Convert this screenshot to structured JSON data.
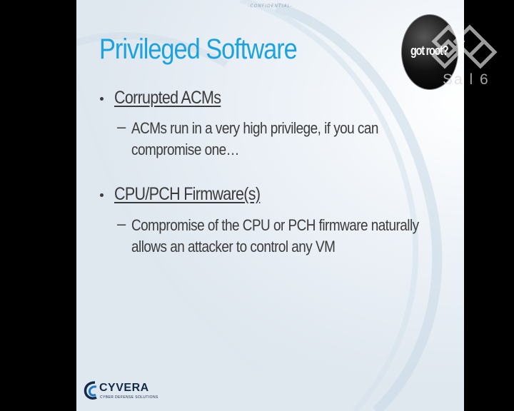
{
  "slide": {
    "confidential_label": "-CONFIDENTIAL-",
    "title": "Privileged Software",
    "bullets": [
      {
        "label": "Corrupted ACMs",
        "sub_lines": [
          "ACMs run in a very high privilege, if you can",
          "compromise one…"
        ]
      },
      {
        "label": "CPU/PCH Firmware(s)",
        "sub_lines": [
          "Compromise of the CPU or PCH firmware naturally",
          "allows an attacker to control any VM"
        ]
      }
    ],
    "dash": "–",
    "bullet_glyph": "•"
  },
  "logo": {
    "name": "CYVERA",
    "tagline": "CYBER DEFENSE SOLUTIONS",
    "icon": "cyvera-swirl-icon"
  },
  "overlay": {
    "badge_text": "got root?",
    "channel_text": "Sa l 6",
    "channel_icon": "channel-lattice-icon"
  },
  "colors": {
    "title": "#1aa3de",
    "text": "#3b3b3b",
    "logo_navy": "#142a4a",
    "logo_blue": "#1e78c8",
    "letterbox": "#000000"
  }
}
